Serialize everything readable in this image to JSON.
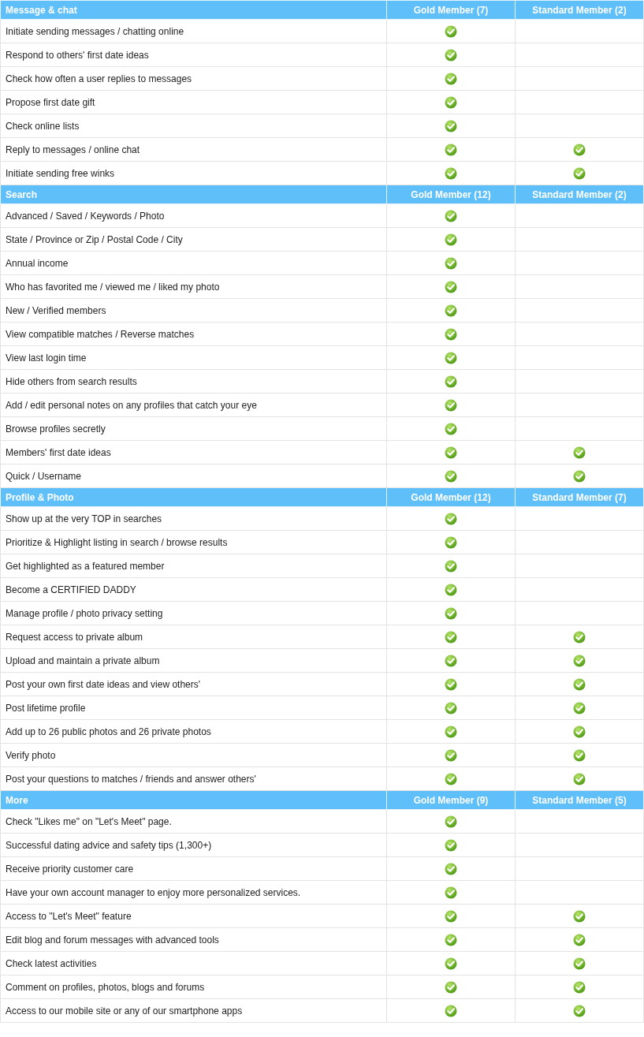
{
  "sections": [
    {
      "title": "Message & chat",
      "gold_header": "Gold Member (7)",
      "standard_header": "Standard Member (2)",
      "rows": [
        {
          "feature": "Initiate sending messages / chatting online",
          "gold": true,
          "standard": false
        },
        {
          "feature": "Respond to others' first date ideas",
          "gold": true,
          "standard": false
        },
        {
          "feature": "Check how often a user replies to messages",
          "gold": true,
          "standard": false
        },
        {
          "feature": "Propose first date gift",
          "gold": true,
          "standard": false
        },
        {
          "feature": "Check online lists",
          "gold": true,
          "standard": false
        },
        {
          "feature": "Reply to messages / online chat",
          "gold": true,
          "standard": true
        },
        {
          "feature": "Initiate sending free winks",
          "gold": true,
          "standard": true
        }
      ]
    },
    {
      "title": "Search",
      "gold_header": "Gold Member (12)",
      "standard_header": "Standard Member (2)",
      "rows": [
        {
          "feature": "Advanced / Saved / Keywords / Photo",
          "gold": true,
          "standard": false
        },
        {
          "feature": "State / Province or Zip / Postal Code / City",
          "gold": true,
          "standard": false
        },
        {
          "feature": "Annual income",
          "gold": true,
          "standard": false
        },
        {
          "feature": "Who has favorited me / viewed me / liked my photo",
          "gold": true,
          "standard": false
        },
        {
          "feature": "New / Verified members",
          "gold": true,
          "standard": false
        },
        {
          "feature": "View compatible matches / Reverse matches",
          "gold": true,
          "standard": false
        },
        {
          "feature": "View last login time",
          "gold": true,
          "standard": false
        },
        {
          "feature": "Hide others from search results",
          "gold": true,
          "standard": false
        },
        {
          "feature": "Add / edit personal notes on any profiles that catch your eye",
          "gold": true,
          "standard": false
        },
        {
          "feature": "Browse profiles secretly",
          "gold": true,
          "standard": false
        },
        {
          "feature": "Members' first date ideas",
          "gold": true,
          "standard": true
        },
        {
          "feature": "Quick / Username",
          "gold": true,
          "standard": true
        }
      ]
    },
    {
      "title": "Profile & Photo",
      "gold_header": "Gold Member (12)",
      "standard_header": "Standard Member (7)",
      "rows": [
        {
          "feature": "Show up at the very TOP in searches",
          "gold": true,
          "standard": false
        },
        {
          "feature": "Prioritize & Highlight listing in search / browse results",
          "gold": true,
          "standard": false
        },
        {
          "feature": "Get highlighted as a featured member",
          "gold": true,
          "standard": false
        },
        {
          "feature": "Become a CERTIFIED DADDY",
          "gold": true,
          "standard": false
        },
        {
          "feature": "Manage profile / photo privacy setting",
          "gold": true,
          "standard": false
        },
        {
          "feature": "Request access to private album",
          "gold": true,
          "standard": true
        },
        {
          "feature": "Upload and maintain a private album",
          "gold": true,
          "standard": true
        },
        {
          "feature": "Post your own first date ideas and view others'",
          "gold": true,
          "standard": true
        },
        {
          "feature": "Post lifetime profile",
          "gold": true,
          "standard": true
        },
        {
          "feature": "Add up to 26 public photos and 26 private photos",
          "gold": true,
          "standard": true
        },
        {
          "feature": "Verify photo",
          "gold": true,
          "standard": true
        },
        {
          "feature": "Post your questions to matches / friends and answer others'",
          "gold": true,
          "standard": true
        }
      ]
    },
    {
      "title": "More",
      "gold_header": "Gold Member (9)",
      "standard_header": "Standard Member (5)",
      "rows": [
        {
          "feature": "Check \"Likes me\" on \"Let's Meet\" page.",
          "gold": true,
          "standard": false
        },
        {
          "feature": "Successful dating advice and safety tips (1,300+)",
          "gold": true,
          "standard": false
        },
        {
          "feature": "Receive priority customer care",
          "gold": true,
          "standard": false
        },
        {
          "feature": "Have your own account manager to enjoy more personalized services.",
          "gold": true,
          "standard": false
        },
        {
          "feature": "Access to \"Let's Meet\" feature",
          "gold": true,
          "standard": true
        },
        {
          "feature": "Edit blog and forum messages with advanced tools",
          "gold": true,
          "standard": true
        },
        {
          "feature": "Check latest activities",
          "gold": true,
          "standard": true
        },
        {
          "feature": "Comment on profiles, photos, blogs and forums",
          "gold": true,
          "standard": true
        },
        {
          "feature": "Access to our mobile site or any of our smartphone apps",
          "gold": true,
          "standard": true
        }
      ]
    }
  ]
}
